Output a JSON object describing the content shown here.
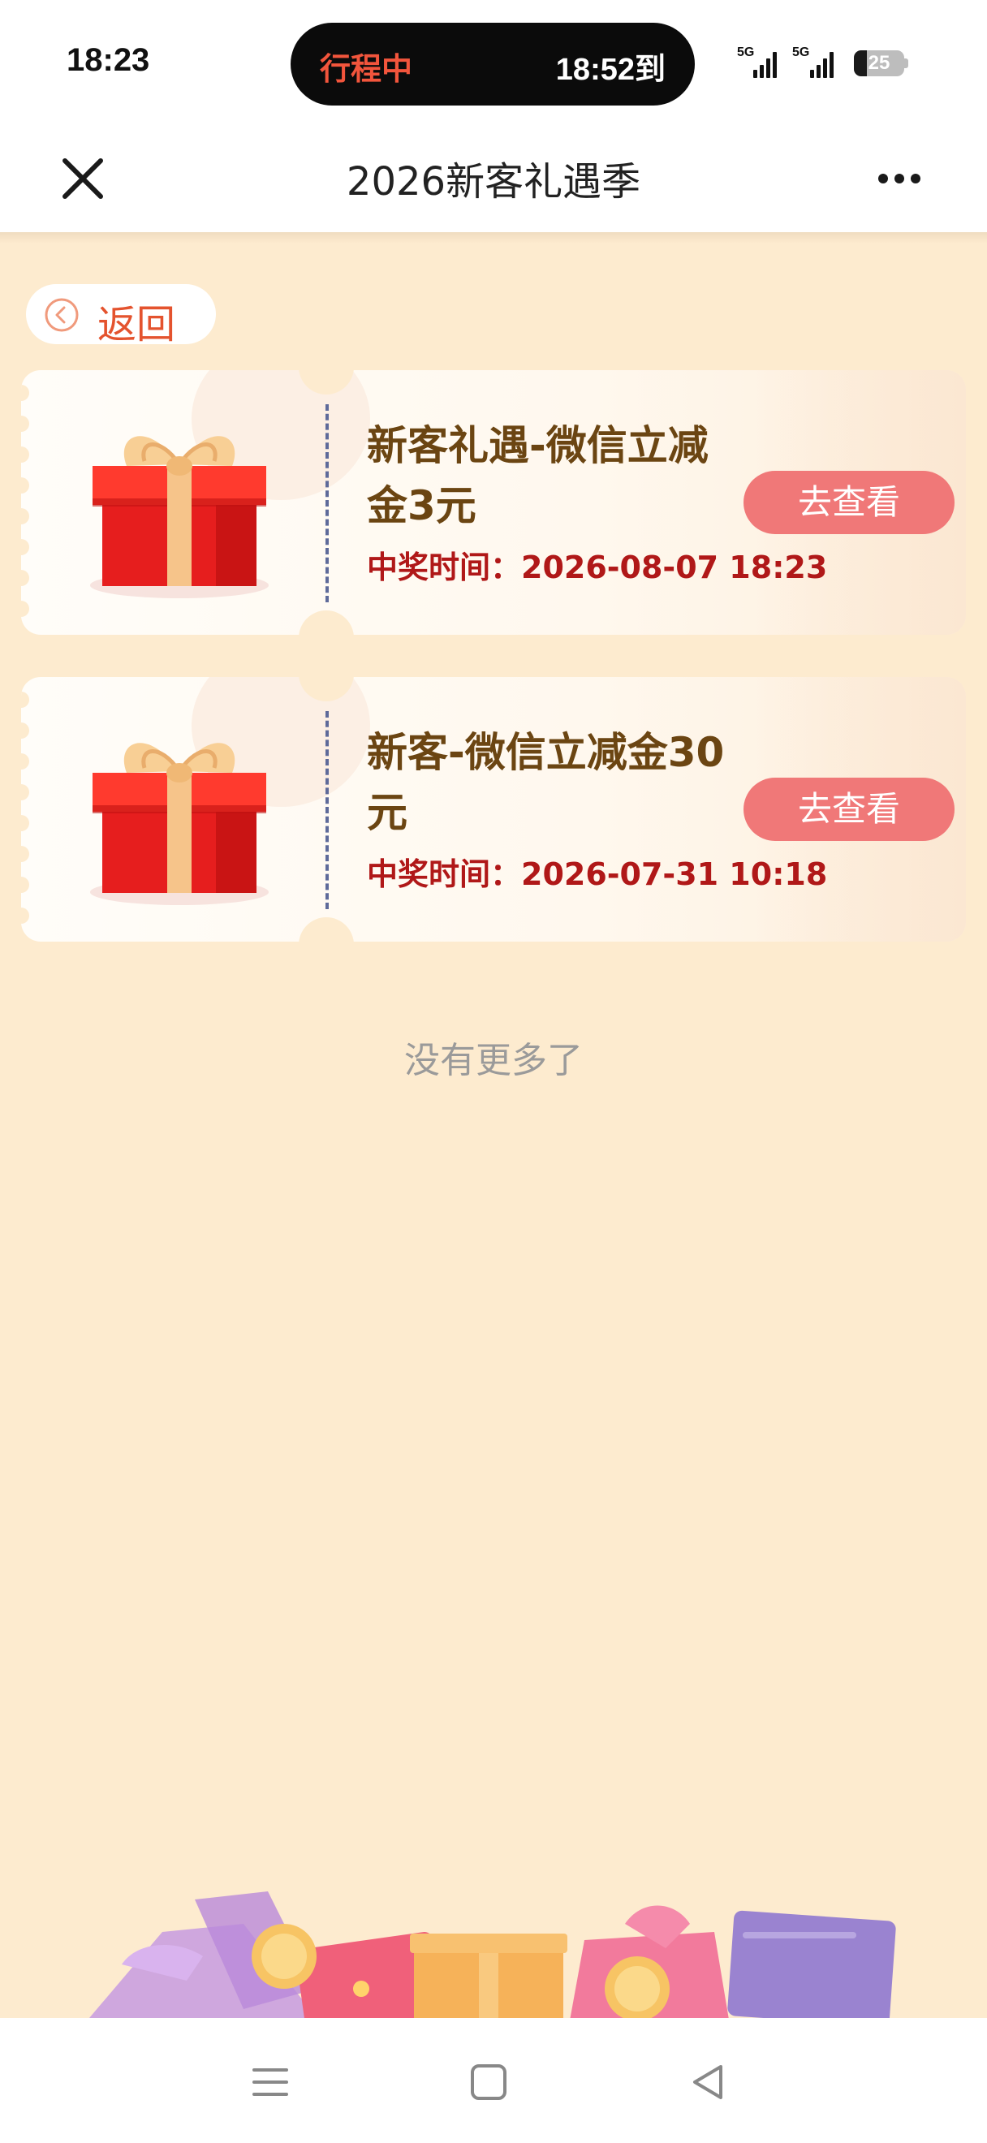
{
  "status_bar": {
    "time": "18:23",
    "island_left": "行程中",
    "island_right": "18:52到",
    "signal1_label": "5G",
    "signal2_label": "5G",
    "battery_level": "25"
  },
  "title_bar": {
    "title": "2026新客礼遇季",
    "close_icon": "close-icon",
    "more_icon": "more-icon"
  },
  "back": {
    "label": "返回",
    "icon": "chevron-left-circle-icon"
  },
  "cards": [
    {
      "name": "新客礼遇-微信立减金3元",
      "time_label": "中奖时间：",
      "time_value": "2026-08-07 18:23",
      "button": "去查看"
    },
    {
      "name": "新客-微信立减金30元",
      "time_label": "中奖时间：",
      "time_value": "2026-07-31 10:18",
      "button": "去查看"
    }
  ],
  "footer_text": "没有更多了",
  "colors": {
    "background": "#fdebcf",
    "accent": "#e4532e",
    "button": "#f07878",
    "title_text": "#6b4512",
    "time_text": "#b01818"
  }
}
